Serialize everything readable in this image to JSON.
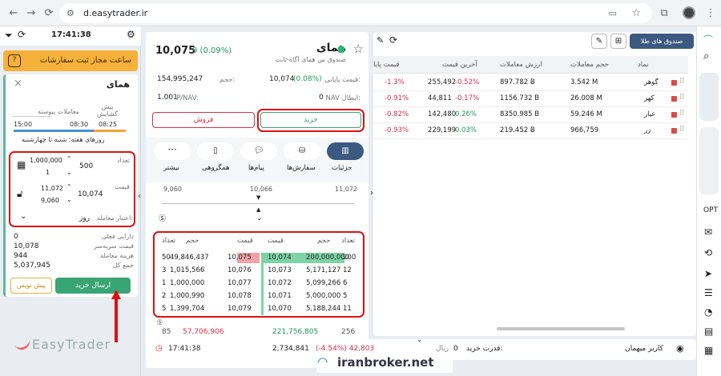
{
  "browser": {
    "url": "d.easytrader.ir"
  },
  "left": {
    "time": "17:41:38",
    "rules_banner": "ساعت مجاز ثبت سفارشات",
    "rules_icon": "?",
    "symbol": "همای",
    "close": "×",
    "sessions": {
      "pre": "پیش\nگشایش",
      "continuous": "معاملات پیوسته",
      "t1": "08:25",
      "t2": "08:30",
      "t3": "15:00"
    },
    "days": "روزهای هفته: شنبه تا چهارشنبه",
    "qty_label": "تعداد",
    "qty_value": "500",
    "qty_options": [
      "1,000,000",
      "1"
    ],
    "price_label": "قیمت",
    "price_value": "10,074",
    "price_options": [
      "11,072",
      "9,060"
    ],
    "validity_label": "اعتبار معامله:",
    "validity_value": "روز",
    "summary": [
      {
        "label": "دارایی فعلی",
        "value": "0"
      },
      {
        "label": "قیمت سربه‌سر",
        "value": "10,078"
      },
      {
        "label": "هزینه معامله",
        "value": "944"
      },
      {
        "label": "جمع کل",
        "value": "5,037,945"
      }
    ],
    "buy_button": "ارسال خرید",
    "draft_button": "پیش نویس",
    "logo": "EasyTrader"
  },
  "mid": {
    "symbol": "همای",
    "subtitle": "صندوق س همای آگاه-ثابت",
    "last_price": "10,075",
    "change": "9 (0.09%)",
    "close_label": "قیمت پایانی:",
    "close_value": "10,074",
    "close_change": "(0.08%)",
    "volume_label": "حجم:",
    "volume_value": "154,995,247",
    "nav_label": "NAV ابطال:",
    "nav_value": "0",
    "pnav_label": "P/NAV:",
    "pnav_value": "1.001",
    "buy": "خرید",
    "sell": "فروش",
    "tabs": [
      "جزئیات",
      "سفارش‌ها",
      "پیام‌ها",
      "همگروهی",
      "بیشتر"
    ],
    "range_low": "9,060",
    "range_mid": "10,066",
    "range_high": "11,072",
    "ob_headers": {
      "count": "تعداد",
      "vol": "حجم",
      "price": "قیمت"
    },
    "orderbook": [
      {
        "bc": "200",
        "bv": "200,000,000",
        "bp": "10,074",
        "sp": "10,075",
        "sv": "49,846,437",
        "sc": "50"
      },
      {
        "bc": "12",
        "bv": "5,171,127",
        "bp": "10,073",
        "sp": "10,076",
        "sv": "1,015,566",
        "sc": "3"
      },
      {
        "bc": "6",
        "bv": "5,099,266",
        "bp": "10,072",
        "sp": "10,077",
        "sv": "1,000,000",
        "sc": "1"
      },
      {
        "bc": "5",
        "bv": "5,000,000",
        "bp": "10,071",
        "sp": "10,078",
        "sv": "1,000,990",
        "sc": "2"
      },
      {
        "bc": "11",
        "bv": "5,188,244",
        "bp": "10,070",
        "sp": "10,079",
        "sv": "1,399,704",
        "sc": "5"
      }
    ],
    "ob_footer": {
      "bc": "256",
      "bv": "221,756,805",
      "sv": "57,706,906",
      "sc": "85"
    }
  },
  "right": {
    "gold_button": "صندوق های طلا",
    "headers": [
      "نماد",
      "حجم معاملات",
      "ارزش معاملات",
      "آخرین قیمت",
      "",
      "قیمت پایا"
    ],
    "rows": [
      {
        "sym": "گوهر",
        "vol": "3.542 M",
        "val": "897.782 B",
        "last": "255,492",
        "lastpct": "-0.52%",
        "close": "",
        "closepct": "-1.3%"
      },
      {
        "sym": "کهر",
        "vol": "26.008 M",
        "val": "1156.732 B",
        "last": "44,811",
        "lastpct": "-0.17%",
        "close": "",
        "closepct": "-0.91%"
      },
      {
        "sym": "عیار",
        "vol": "59.246 M",
        "val": "8350.985 B",
        "last": "142,480",
        "lastpct": "0.26%",
        "close": "",
        "closepct": "-0.82%"
      },
      {
        "sym": "زر",
        "vol": "966,759",
        "val": "219.452 B",
        "last": "229,199",
        "lastpct": "0.03%",
        "close": "",
        "closepct": "-0.93%"
      }
    ]
  },
  "bottom": {
    "time": "17:41:38",
    "index": "2,734,841",
    "index_change": "(-4.54%) 42,803",
    "power_label": "قدرت خرید:",
    "power_value": "0",
    "power_unit": "ریال",
    "user": "کاربر میهمان"
  },
  "watermark": "iranbroker.net"
}
